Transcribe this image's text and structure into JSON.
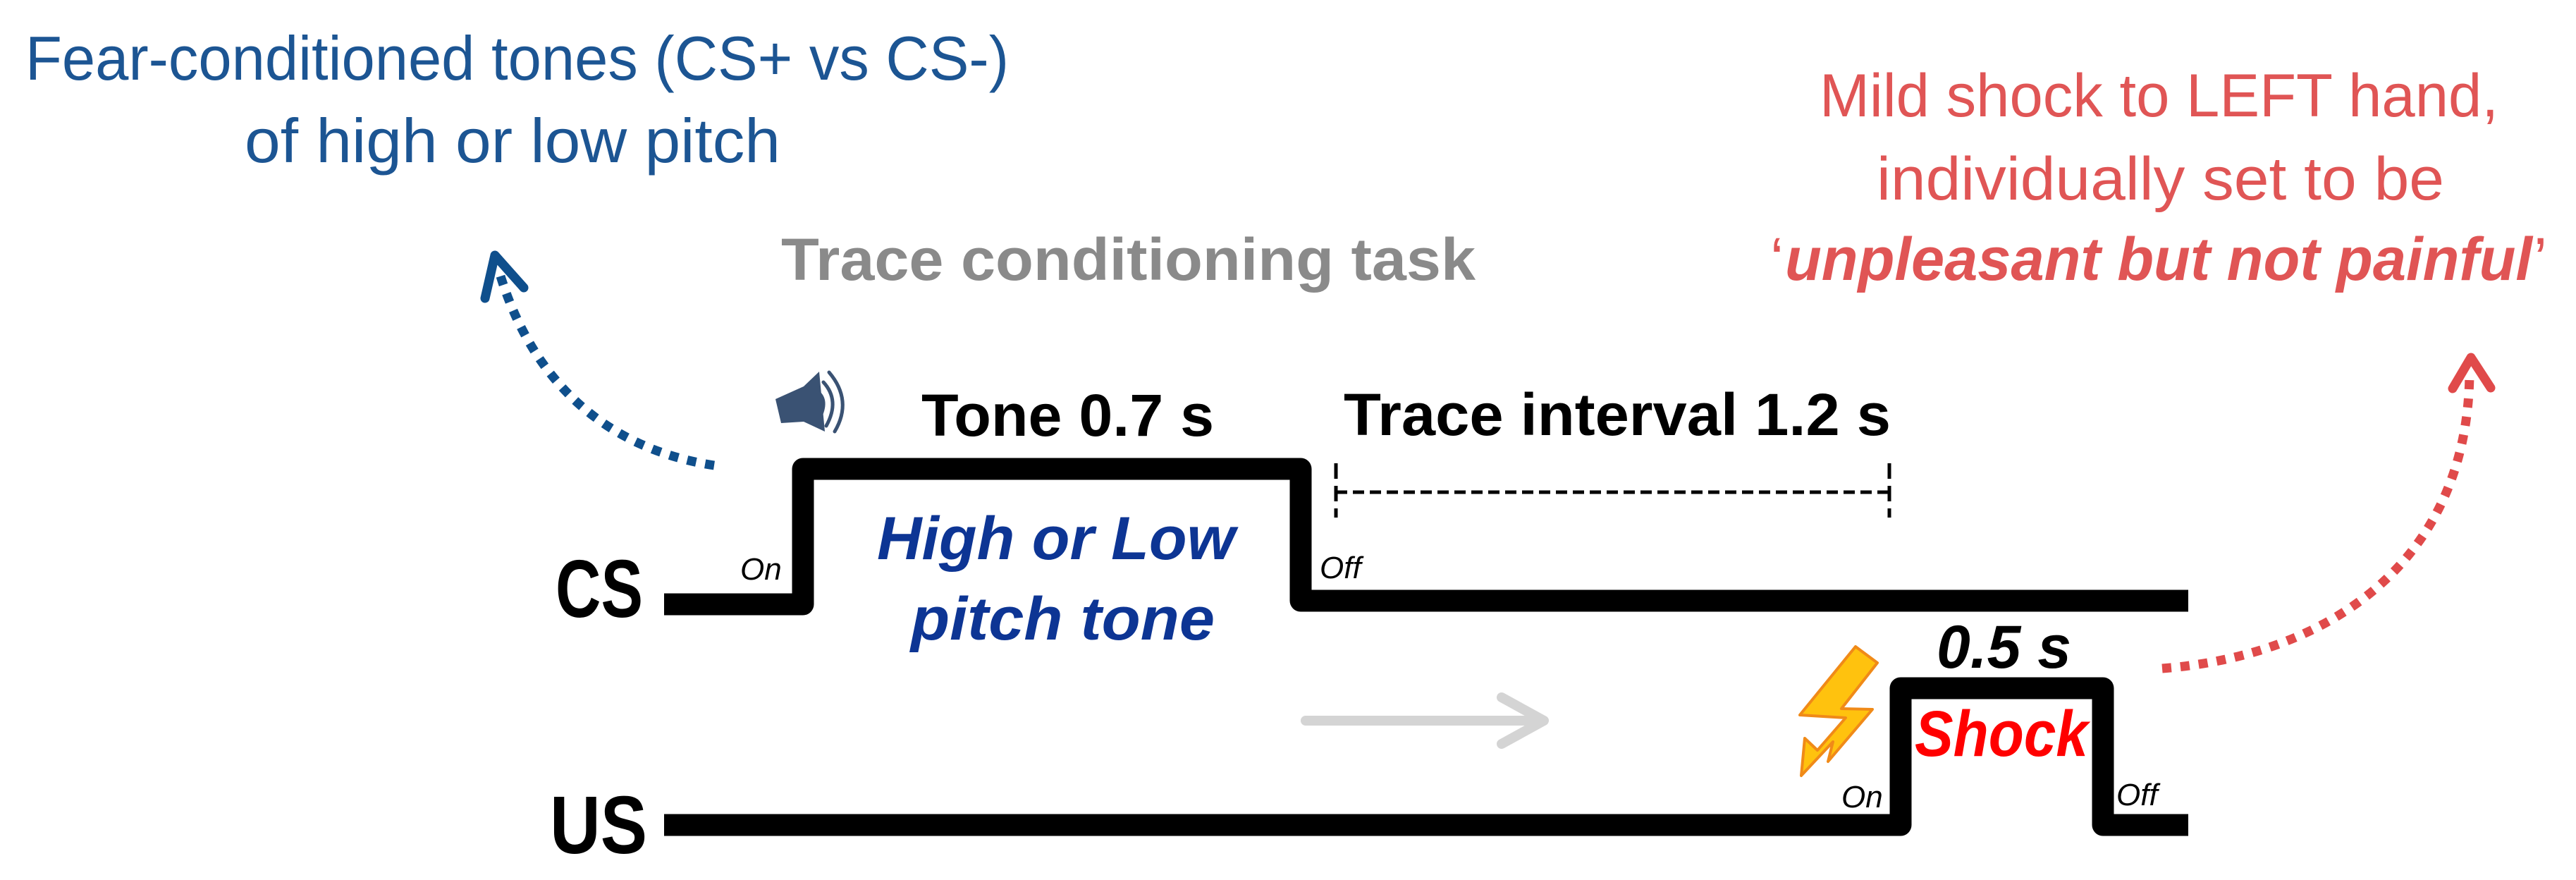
{
  "diagram": {
    "title": "Trace conditioning task",
    "cs_annotation": {
      "lines": [
        "Fear-conditioned  tones (CS+ vs CS-)",
        "of high or low pitch"
      ],
      "color": "#1c5593"
    },
    "us_annotation": {
      "lines": [
        "Mild shock to LEFT hand,",
        "individually set to be"
      ],
      "quote_open": "‘",
      "emphasis": "unpleasant  but  not  painful",
      "quote_close": "’",
      "color": "#e05555"
    },
    "cs_row": {
      "label": "CS",
      "on_label": "On",
      "off_label": "Off",
      "stimulus_icon": "speaker-icon",
      "duration_label": "Tone 0.7 s",
      "stimulus_lines": [
        "High or Low",
        "pitch tone"
      ],
      "stimulus_color": "#0d3594"
    },
    "trace": {
      "label": "Trace interval 1.2 s"
    },
    "us_row": {
      "label": "US",
      "on_label": "On",
      "off_label": "Off",
      "stimulus_icon": "lightning-bolt-icon",
      "duration_label": "0.5 s",
      "stimulus_label": "Shock",
      "stimulus_color": "#ff0000"
    },
    "timing_seconds": {
      "tone_duration": 0.7,
      "trace_interval": 1.2,
      "shock_duration": 0.5
    },
    "colors": {
      "cs_arrow": "#0f4f8c",
      "us_arrow": "#e04a4a",
      "time_arrow": "#d4d4d4",
      "title_gray": "#8a8a8a"
    }
  }
}
